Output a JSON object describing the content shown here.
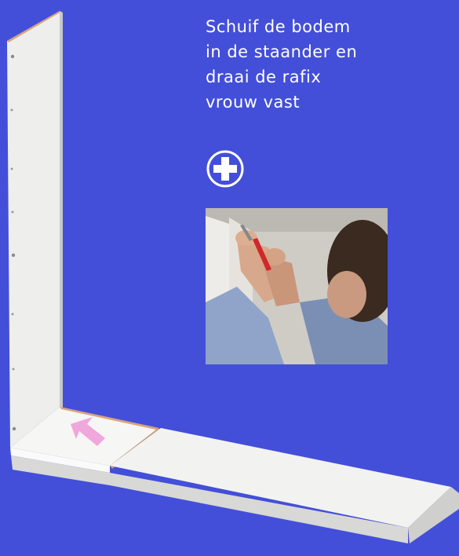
{
  "instruction": {
    "text": "Schuif de bodem\nin de staander en\ndraai de rafix\nvrouw vast"
  },
  "icons": {
    "tool": "screwdriver-phillips-icon",
    "direction": "arrow-up-left-icon"
  },
  "colors": {
    "background": "#434fd8",
    "text": "#ffffff",
    "arrow": "#f0a7dc",
    "panel": "#f4f4f2",
    "panel_edge": "#d8b08a"
  }
}
